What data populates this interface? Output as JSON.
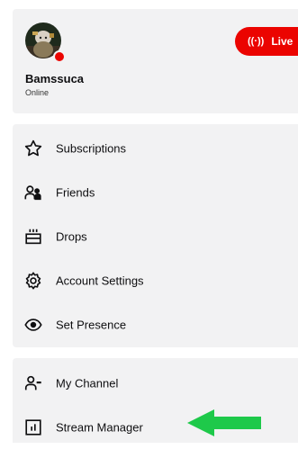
{
  "profile": {
    "username": "Bamssuca",
    "status": "Online",
    "live_button": {
      "icon_glyph": "((·))",
      "label": "Live",
      "color": "#eb0400"
    }
  },
  "menu": {
    "items": [
      {
        "label": "Subscriptions",
        "icon": "star-icon"
      },
      {
        "label": "Friends",
        "icon": "friends-icon"
      },
      {
        "label": "Drops",
        "icon": "drops-icon"
      },
      {
        "label": "Account Settings",
        "icon": "gear-icon"
      },
      {
        "label": "Set Presence",
        "icon": "eye-icon"
      }
    ]
  },
  "channel_menu": {
    "items": [
      {
        "label": "My Channel",
        "icon": "channel-icon"
      },
      {
        "label": "Stream Manager",
        "icon": "stream-manager-icon"
      }
    ]
  },
  "annotation": {
    "arrow_color": "#1ec94a"
  }
}
